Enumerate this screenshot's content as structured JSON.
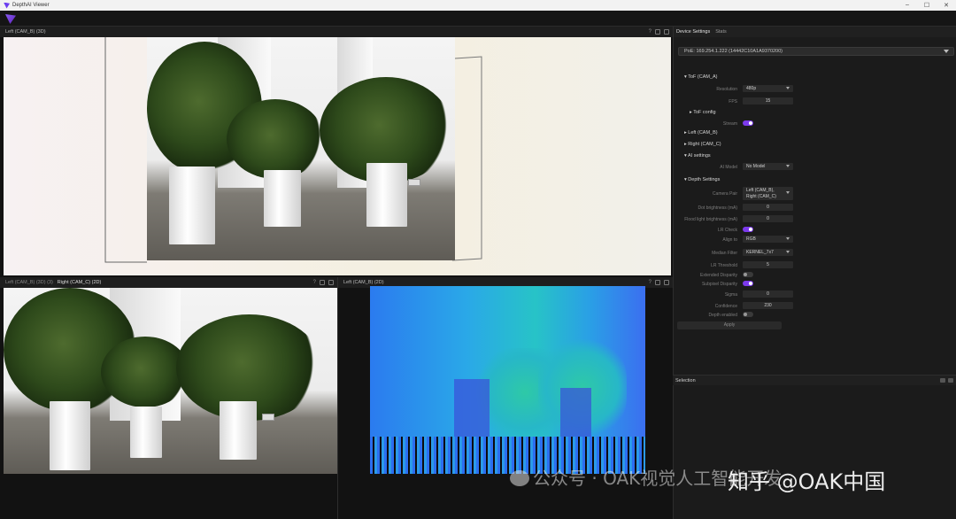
{
  "window": {
    "title": "DepthAI Viewer",
    "controls": [
      "–",
      "☐",
      "✕"
    ]
  },
  "panels": {
    "top": {
      "title": "Left (CAM_B) (3D)"
    },
    "bottom_left": {
      "title_a": "Left (CAM_B) (3D) (3)",
      "title_b": "Right (CAM_C) (2D)"
    },
    "bottom_right": {
      "title": "Left (CAM_B) (2D)"
    },
    "help": "?"
  },
  "side": {
    "tabs": [
      "Device Settings",
      "Stats"
    ],
    "device": "PoE: 169.254.1.222 (14442C10A1A9370200)",
    "tof": {
      "header": "▾ ToF (CAM_A)",
      "resolution_label": "Resolution",
      "resolution": "480p",
      "fps_label": "FPS",
      "fps": "15",
      "config": "▸ ToF config",
      "stream_label": "Stream"
    },
    "left": "▸ Left (CAM_B)",
    "right": "▸ Right (CAM_C)",
    "ai": {
      "header": "▾ AI settings",
      "model_label": "AI Model",
      "model": "No Model"
    },
    "depth": {
      "header": "▾ Depth Settings",
      "camera_pair_label": "Camera Pair",
      "camera_pair_1": "Left (CAM_B),",
      "camera_pair_2": "Right (CAM_C)",
      "dot_label": "Dot brightness (mA)",
      "dot": "0",
      "flood_label": "Flood light brightness (mA)",
      "flood": "0",
      "lr_label": "LR Check",
      "align_label": "Align to",
      "align": "RGB",
      "median_label": "Median Filter",
      "median": "KERNEL_7x7",
      "lrt_label": "LR Threshold",
      "lrt": "5",
      "ext_label": "Extended Disparity",
      "sub_label": "Subpixel Disparity",
      "sigma_label": "Sigma",
      "sigma": "0",
      "conf_label": "Confidence",
      "conf": "230",
      "denab_label": "Depth enabled"
    },
    "apply": "Apply",
    "selection": "Selection"
  },
  "watermark": {
    "a": "公众号 · OAK视觉人工智能开发",
    "b": "知乎 @OAK中国"
  },
  "colors": {
    "accent": "#7c3aed"
  }
}
